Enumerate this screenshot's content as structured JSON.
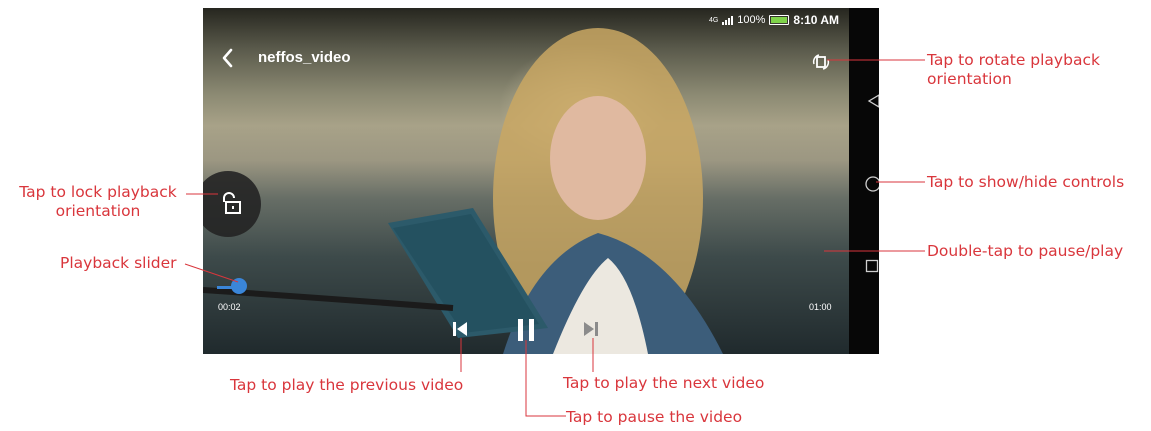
{
  "status": {
    "signal": "4G",
    "battery": "100%",
    "time": "8:10 AM"
  },
  "player": {
    "title": "neffos_video",
    "current_time": "00:02",
    "duration": "01:00",
    "progress_fraction": 0.03
  },
  "icons": {
    "back": "back-arrow-icon",
    "rotate": "rotate-orientation-icon",
    "lock": "unlocked-padlock-icon",
    "prev": "skip-previous-icon",
    "pause": "pause-icon",
    "next": "skip-next-icon",
    "nav_back": "nav-back-icon",
    "nav_home": "nav-home-icon",
    "nav_recent": "nav-recent-icon"
  },
  "annotations": {
    "rotate": "Tap to rotate playback\norientation",
    "lock": "Tap to lock playback\norientation",
    "show_hide": "Tap to show/hide controls",
    "double_tap": "Double-tap to pause/play",
    "slider": "Playback slider",
    "previous": "Tap to play the previous video",
    "next": "Tap to play the next video",
    "pause": "Tap to pause the video"
  },
  "colors": {
    "annotation": "#d9363c",
    "slider": "#3a86d9"
  }
}
